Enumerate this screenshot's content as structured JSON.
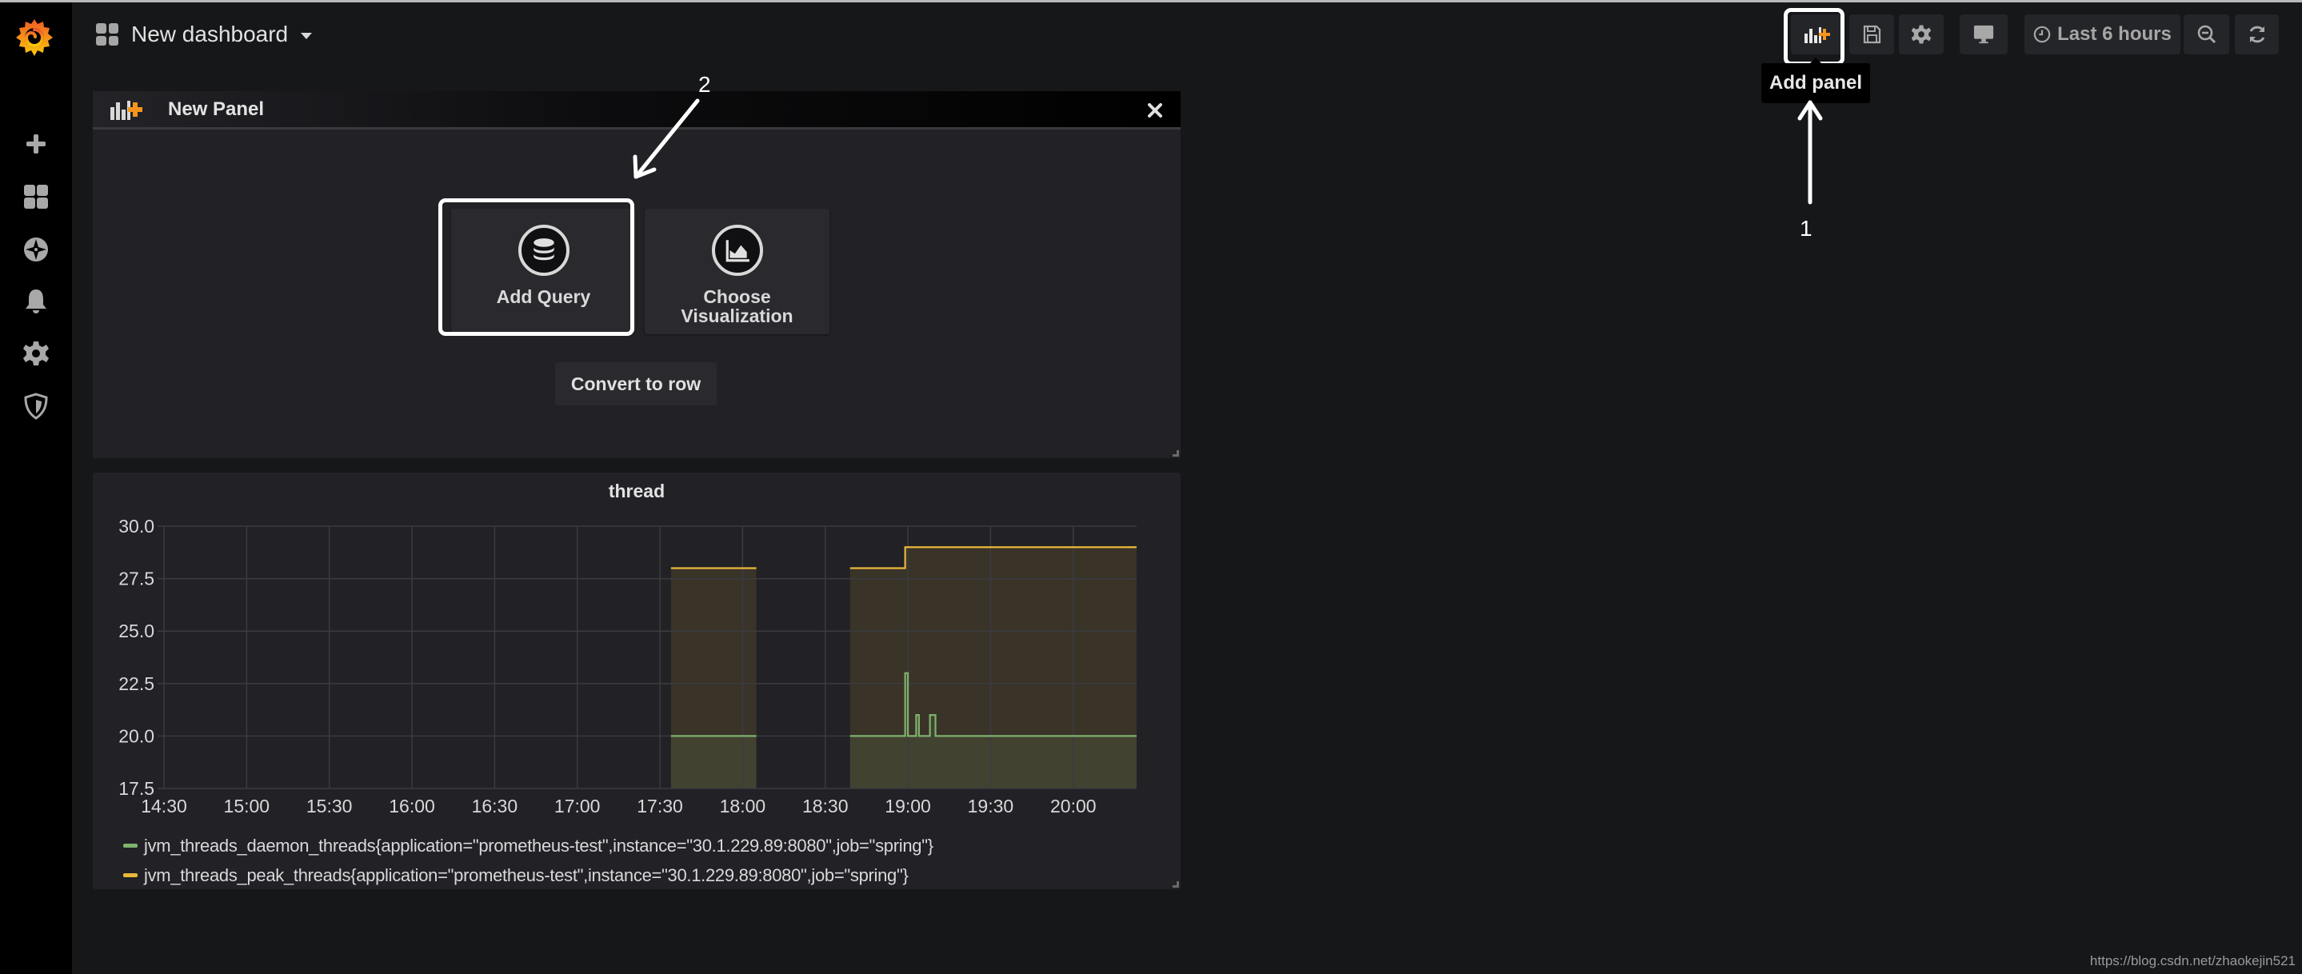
{
  "app": {
    "dashboard_title": "New dashboard"
  },
  "sidebar": {
    "logo": "grafana-logo",
    "items": [
      {
        "name": "create",
        "icon": "plus-icon"
      },
      {
        "name": "dashboards",
        "icon": "dashboards-grid-icon"
      },
      {
        "name": "explore",
        "icon": "compass-icon"
      },
      {
        "name": "alerting",
        "icon": "bell-icon"
      },
      {
        "name": "configuration",
        "icon": "gear-icon"
      },
      {
        "name": "server-admin",
        "icon": "shield-icon"
      }
    ]
  },
  "toolbar": {
    "add_panel_icon": "add-panel-icon",
    "save_icon": "save-icon",
    "settings_icon": "gear-icon",
    "view_mode_icon": "monitor-icon",
    "time_range_label": "Last 6 hours",
    "zoom_out_icon": "zoom-out-icon",
    "refresh_icon": "refresh-icon",
    "tooltip": "Add panel"
  },
  "annotations": {
    "step1": "1",
    "step2": "2"
  },
  "new_panel": {
    "title": "New Panel",
    "add_query_label": "Add Query",
    "choose_viz_label_line1": "Choose",
    "choose_viz_label_line2": "Visualization",
    "convert_to_row_label": "Convert to row"
  },
  "chart_data": {
    "type": "line",
    "title": "thread",
    "xlabel": "",
    "ylabel": "",
    "ylim": [
      17.5,
      30.0
    ],
    "yticks": [
      "30.0",
      "27.5",
      "25.0",
      "22.5",
      "20.0",
      "17.5"
    ],
    "xlim": [
      "14:30",
      "20:23"
    ],
    "xticks": [
      "14:30",
      "15:00",
      "15:30",
      "16:00",
      "16:30",
      "17:00",
      "17:30",
      "18:00",
      "18:30",
      "19:00",
      "19:30",
      "20:00"
    ],
    "grid": true,
    "fill": true,
    "legend_position": "bottom",
    "series": [
      {
        "name": "jvm_threads_daemon_threads{application=\"prometheus-test\",instance=\"30.1.229.89:8080\",job=\"spring\"}",
        "color": "#7eb26d",
        "segments": [
          [
            [
              "17:34",
              20
            ],
            [
              "18:05",
              20
            ]
          ],
          [
            [
              "18:39",
              20
            ],
            [
              "18:59",
              20
            ],
            [
              "18:59",
              23
            ],
            [
              "19:00",
              23
            ],
            [
              "19:00",
              20
            ],
            [
              "19:03",
              20
            ],
            [
              "19:03",
              21
            ],
            [
              "19:04",
              21
            ],
            [
              "19:04",
              20
            ],
            [
              "19:08",
              20
            ],
            [
              "19:08",
              21
            ],
            [
              "19:10",
              21
            ],
            [
              "19:10",
              20
            ],
            [
              "20:23",
              20
            ]
          ]
        ]
      },
      {
        "name": "jvm_threads_peak_threads{application=\"prometheus-test\",instance=\"30.1.229.89:8080\",job=\"spring\"}",
        "color": "#eab839",
        "segments": [
          [
            [
              "17:34",
              28
            ],
            [
              "18:05",
              28
            ]
          ],
          [
            [
              "18:39",
              28
            ],
            [
              "18:59",
              28
            ],
            [
              "18:59",
              29
            ],
            [
              "20:23",
              29
            ]
          ]
        ]
      }
    ]
  },
  "footer": {
    "watermark": "https://blog.csdn.net/zhaokejin521"
  }
}
